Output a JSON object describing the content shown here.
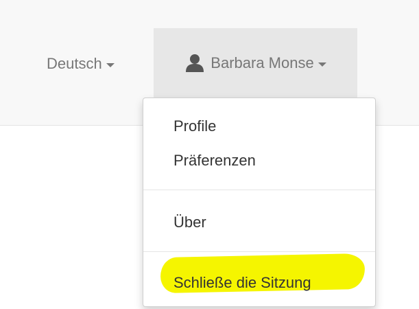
{
  "navbar": {
    "language_label": "Deutsch",
    "user_name": "Barbara Monse"
  },
  "dropdown": {
    "items": [
      {
        "label": "Profile"
      },
      {
        "label": "Präferenzen"
      },
      {
        "label": "Über"
      },
      {
        "label": "Schließe die Sitzung"
      }
    ],
    "highlight_color": "#f5f500"
  },
  "icons": {
    "user": "user-silhouette-icon",
    "caret": "caret-down-icon"
  }
}
